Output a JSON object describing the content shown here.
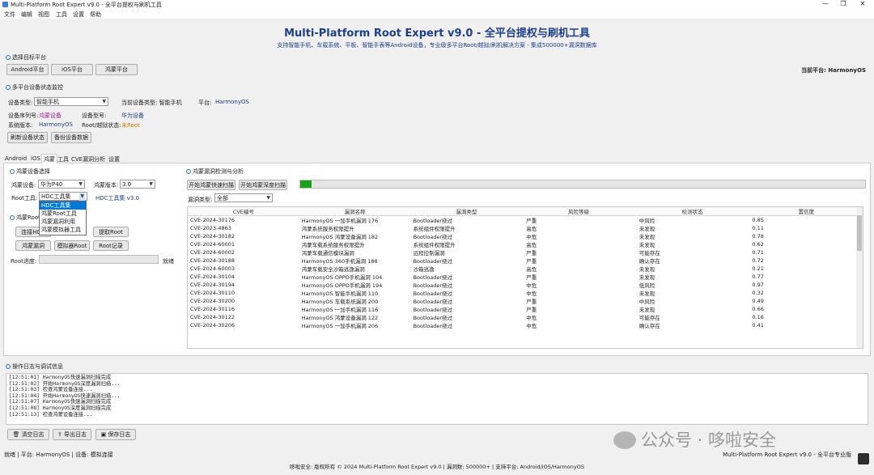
{
  "window": {
    "title": "Multi-Platform Root Expert v9.0 - 全平台提权与刷机工具",
    "controls": [
      "—",
      "❐",
      "✕"
    ]
  },
  "menu": [
    "文件",
    "编辑",
    "视图",
    "工具",
    "设置",
    "帮助"
  ],
  "header": {
    "title": "Multi-Platform Root Expert v9.0 - 全平台提权与刷机工具",
    "subtitle": "支持智能手机、车载系统、平板、智能手表等Android设备，专业级多平台Root/越狱/刷机解决方案 - 集成500000+漏洞数据库"
  },
  "platform_select": {
    "title": "选择目标平台",
    "buttons": [
      "Android平台",
      "iOS平台",
      "鸿蒙平台"
    ],
    "current_label": "当前平台: HarmonyOS"
  },
  "status_monitor": {
    "title": "多平台设备状态监控",
    "device_type_label": "设备类型:",
    "device_type_value": "智能手机",
    "current_type_label": "当前设备类型: 智能手机",
    "platform_label": "平台:",
    "platform_value": "HarmonyOS",
    "serial_label": "设备序列号:",
    "serial_value": "鸿蒙设备",
    "model_label": "设备型号:",
    "model_value": "华为设备",
    "sysver_label": "系统版本:",
    "sysver_value": "HarmonyOS",
    "root_label": "Root/越狱状态:",
    "root_value": "未Root",
    "refresh_button": "刷新设备状态",
    "backup_button": "备份设备数据"
  },
  "tabs": [
    "Android",
    "iOS",
    "鸿蒙",
    "工具",
    "CVE漏洞分析",
    "设置"
  ],
  "harmony_select": {
    "title": "鸿蒙设备选择",
    "device_label": "鸿蒙设备:",
    "device_value": "华为P40",
    "version_label": "鸿蒙版本:",
    "version_value": "3.0",
    "tool_label": "Root工具:",
    "tool_value": "HDC工具集",
    "tool_info": "HDC工具集 v3.0",
    "dropdown_options": [
      "HDC工具集",
      "鸿蒙Root工具",
      "鸿蒙漏洞利用",
      "鸿蒙模拟器工具"
    ]
  },
  "harmony_root": {
    "title": "鸿蒙Root",
    "connect_button": "连接HDC",
    "extract_button": "提取Root",
    "vuln_button": "鸿蒙漏洞",
    "simroot_button": "模拟器Root",
    "record_button": "Root记录",
    "progress_label": "Root进度:",
    "progress_status": "就绪"
  },
  "vuln_panel": {
    "title": "鸿蒙漏洞检测与分析",
    "quick_scan_button": "开始鸿蒙快速扫描",
    "deep_scan_button": "开始鸿蒙深度扫描",
    "progress": 0.02,
    "type_label": "漏洞类型:",
    "type_value": "全部",
    "columns": [
      "CVE编号",
      "漏洞名称",
      "漏洞类型",
      "风险等级",
      "检测状态",
      "置信度"
    ],
    "rows": [
      [
        "CVE-2024-30176",
        "HarmonyOS 一加手机漏洞 176",
        "Bootloader绕过",
        "严重",
        "中风险",
        "0.85"
      ],
      [
        "CVE-2023-4863",
        "鸿蒙系统服务权限提升",
        "系统组件权限提升",
        "高危",
        "未发现",
        "0.11"
      ],
      [
        "CVE-2024-30182",
        "HarmonyOS 鸿蒙设备漏洞 182",
        "Bootloader绕过",
        "中危",
        "未发现",
        "0.78"
      ],
      [
        "CVE-2024-60001",
        "鸿蒙车载系统服务权限提升",
        "系统组件权限提升",
        "高危",
        "未发现",
        "0.62"
      ],
      [
        "CVE-2024-60002",
        "鸿蒙车载通信模块漏洞",
        "远程控制漏洞",
        "严重",
        "可能存在",
        "0.71"
      ],
      [
        "CVE-2024-30188",
        "HarmonyOS 360手机漏洞 188",
        "Bootloader绕过",
        "严重",
        "确认存在",
        "0.72"
      ],
      [
        "CVE-2024-60003",
        "鸿蒙车载安全沙箱逃逸漏洞",
        "沙箱逃逸",
        "高危",
        "未发现",
        "0.21"
      ],
      [
        "CVE-2024-30104",
        "HarmonyOS OPPO手机漏洞 104",
        "Bootloader绕过",
        "严重",
        "未发现",
        "0.77"
      ],
      [
        "CVE-2024-30194",
        "HarmonyOS OPPO手机漏洞 194",
        "Bootloader绕过",
        "中危",
        "低风险",
        "0.97"
      ],
      [
        "CVE-2024-30110",
        "HarmonyOS 智能手机漏洞 110",
        "Bootloader绕过",
        "中危",
        "未发现",
        "0.32"
      ],
      [
        "CVE-2024-30200",
        "HarmonyOS 车载系统漏洞 200",
        "Bootloader绕过",
        "严重",
        "中风险",
        "0.49"
      ],
      [
        "CVE-2024-30116",
        "HarmonyOS 一加手机漏洞 116",
        "Bootloader绕过",
        "严重",
        "未发现",
        "0.66"
      ],
      [
        "CVE-2024-30122",
        "HarmonyOS 鸿蒙设备漏洞 122",
        "Bootloader绕过",
        "中危",
        "可能存在",
        "0.16"
      ],
      [
        "CVE-2024-30206",
        "HarmonyOS 一加手机漏洞 206",
        "Bootloader绕过",
        "中危",
        "确认存在",
        "0.41"
      ]
    ]
  },
  "log_panel": {
    "title": "操作日志与调试信息",
    "lines": [
      "[12:51:01] HarmonyOS快速漏洞扫描完成",
      "[12:51:02] 开始HarmonyOS深度漏洞扫描...",
      "[12:51:03] 检查鸿蒙设备连接...",
      "[12:51:04] 开始HarmonyOS快速漏洞扫描...",
      "[12:51:07] HarmonyOS快速漏洞扫描完成",
      "[12:51:08] HarmonyOS深度漏洞扫描完成",
      "[12:51:13] 检查鸿蒙设备连接..."
    ],
    "clear_button": "清空日志",
    "export_button": "导出日志",
    "save_button": "保存日志"
  },
  "statusbar": {
    "left": "就绪 | 平台: HarmonyOS | 设备: 模拟连接",
    "right": "Multi-Platform Root Expert v9.0 - 全平台专业版",
    "footer": "哆啦安全: 版权所有 © 2024 Multi-Platform Root Expert v9.0 | 漏洞数: 500000+ | 支持平台: Android/iOS/HarmonyOS"
  },
  "watermark": "公众号 · 哆啦安全",
  "colors": {
    "title": "#1f3e8c",
    "accent": "#2f6fc4",
    "magenta": "#a02090",
    "progress": "#1aa31a",
    "selected": "#0078d7"
  }
}
